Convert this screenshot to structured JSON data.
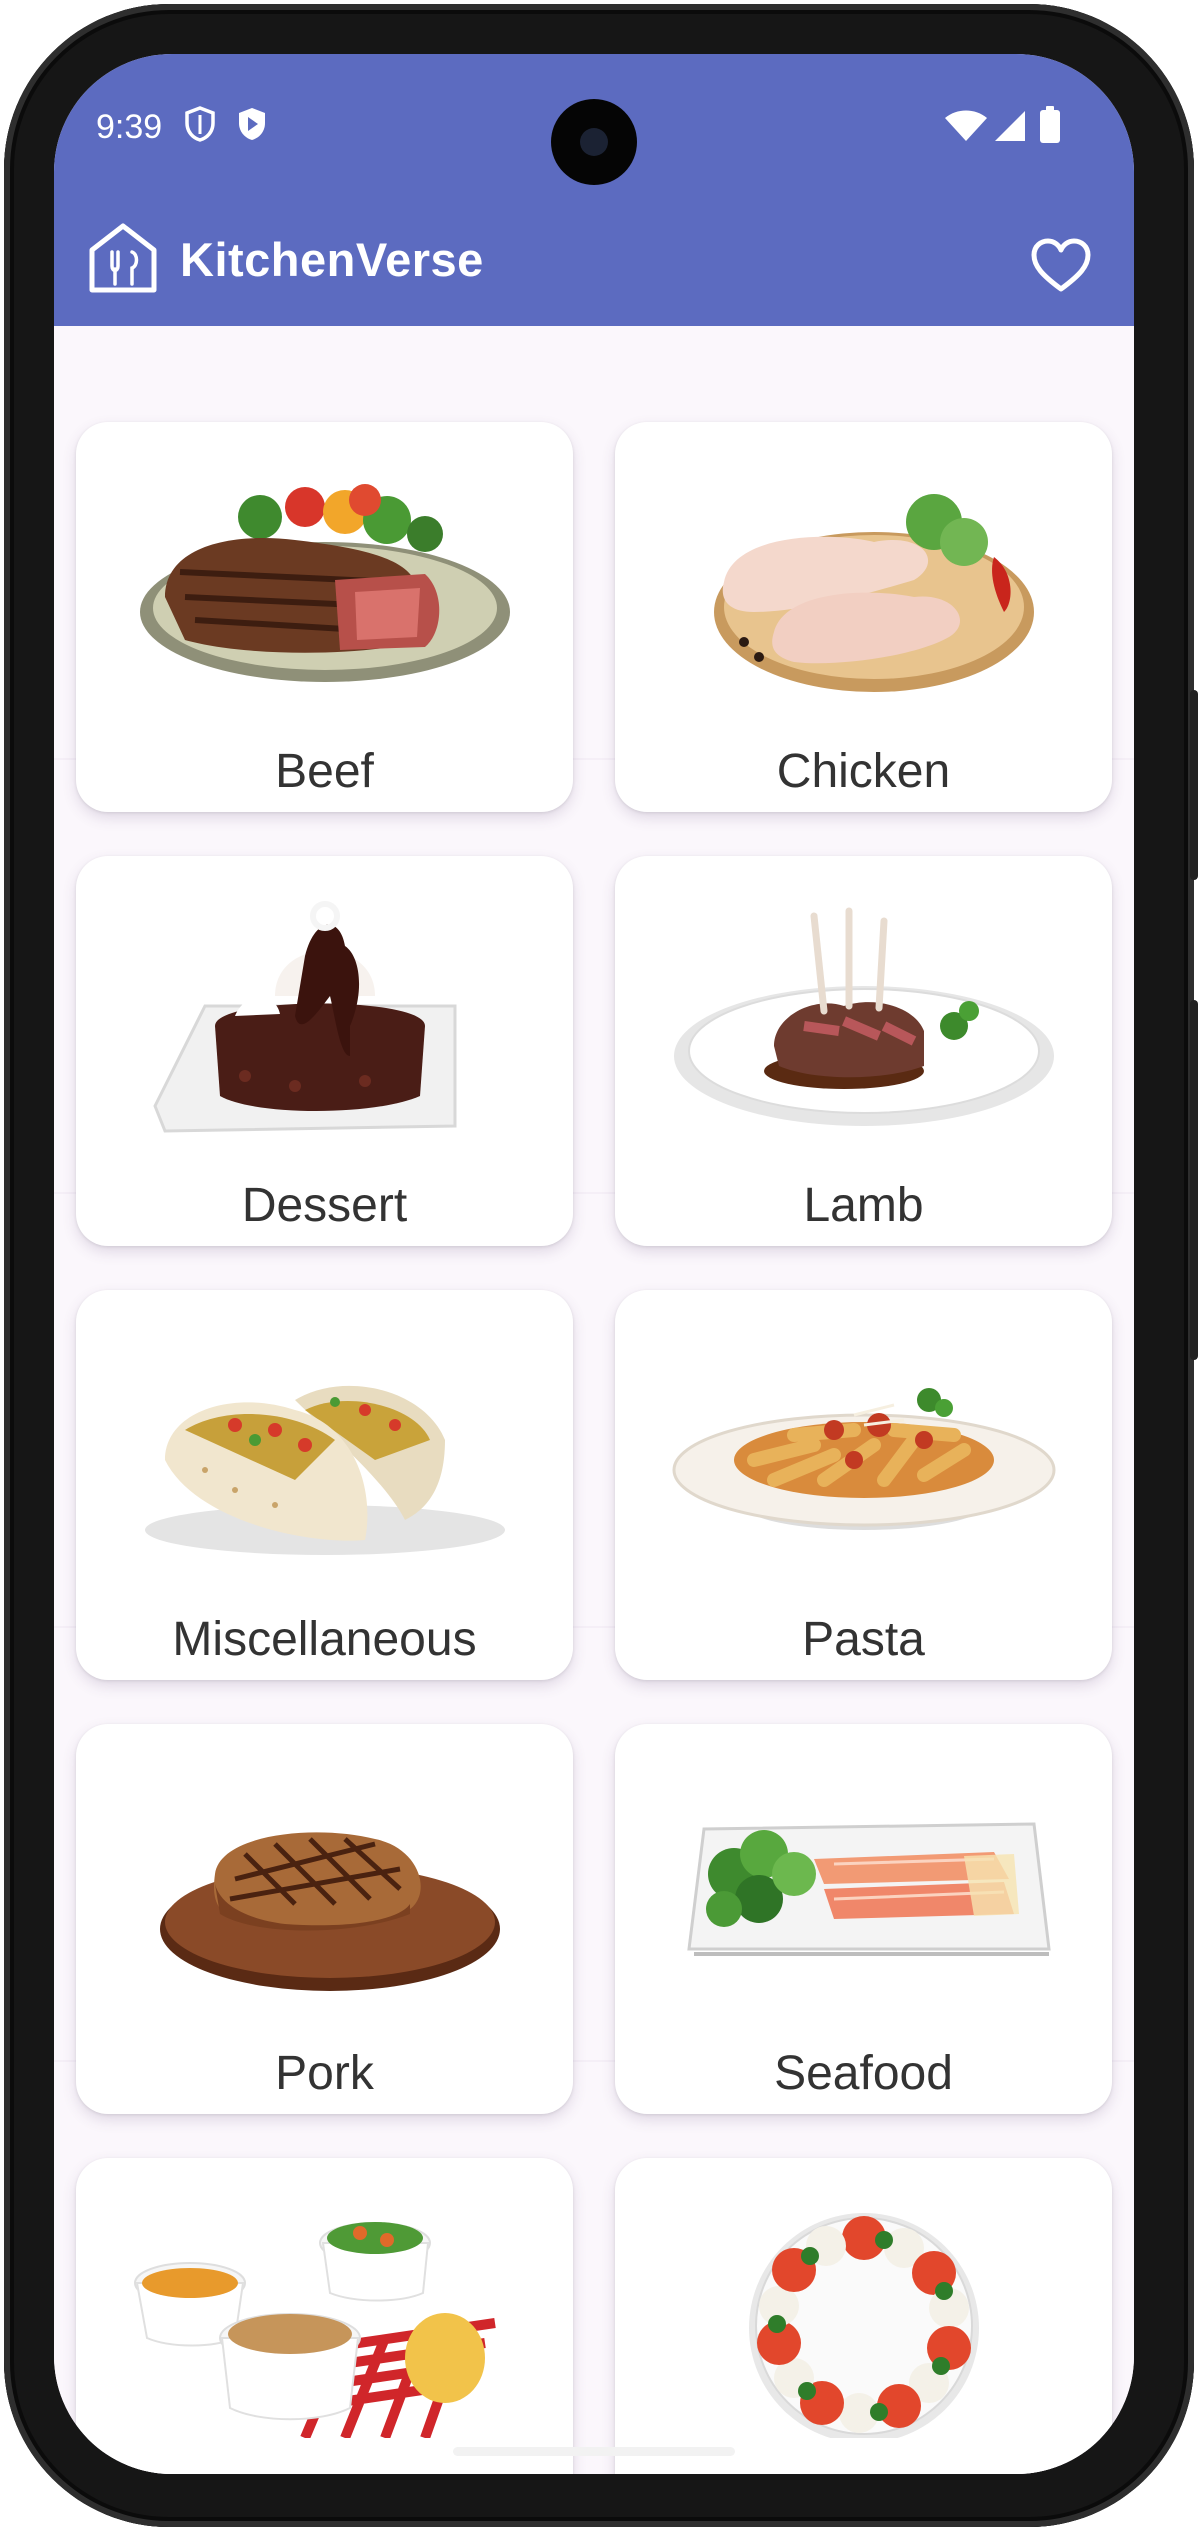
{
  "status_bar": {
    "time": "9:39"
  },
  "app": {
    "title": "KitchenVerse"
  },
  "categories": [
    {
      "label": "Beef"
    },
    {
      "label": "Chicken"
    },
    {
      "label": "Dessert"
    },
    {
      "label": "Lamb"
    },
    {
      "label": "Miscellaneous"
    },
    {
      "label": "Pasta"
    },
    {
      "label": "Pork"
    },
    {
      "label": "Seafood"
    },
    {
      "label": ""
    },
    {
      "label": ""
    }
  ],
  "colors": {
    "app_bar": "#5c6bc0",
    "card_background": "#ffffff",
    "label_text": "#333333"
  },
  "icons": {
    "app_logo": "home-fork-knife-icon",
    "favorites": "heart-outline-icon",
    "status": [
      "shield-icon",
      "play-shield-icon",
      "wifi-icon",
      "cellular-icon",
      "battery-icon"
    ]
  }
}
